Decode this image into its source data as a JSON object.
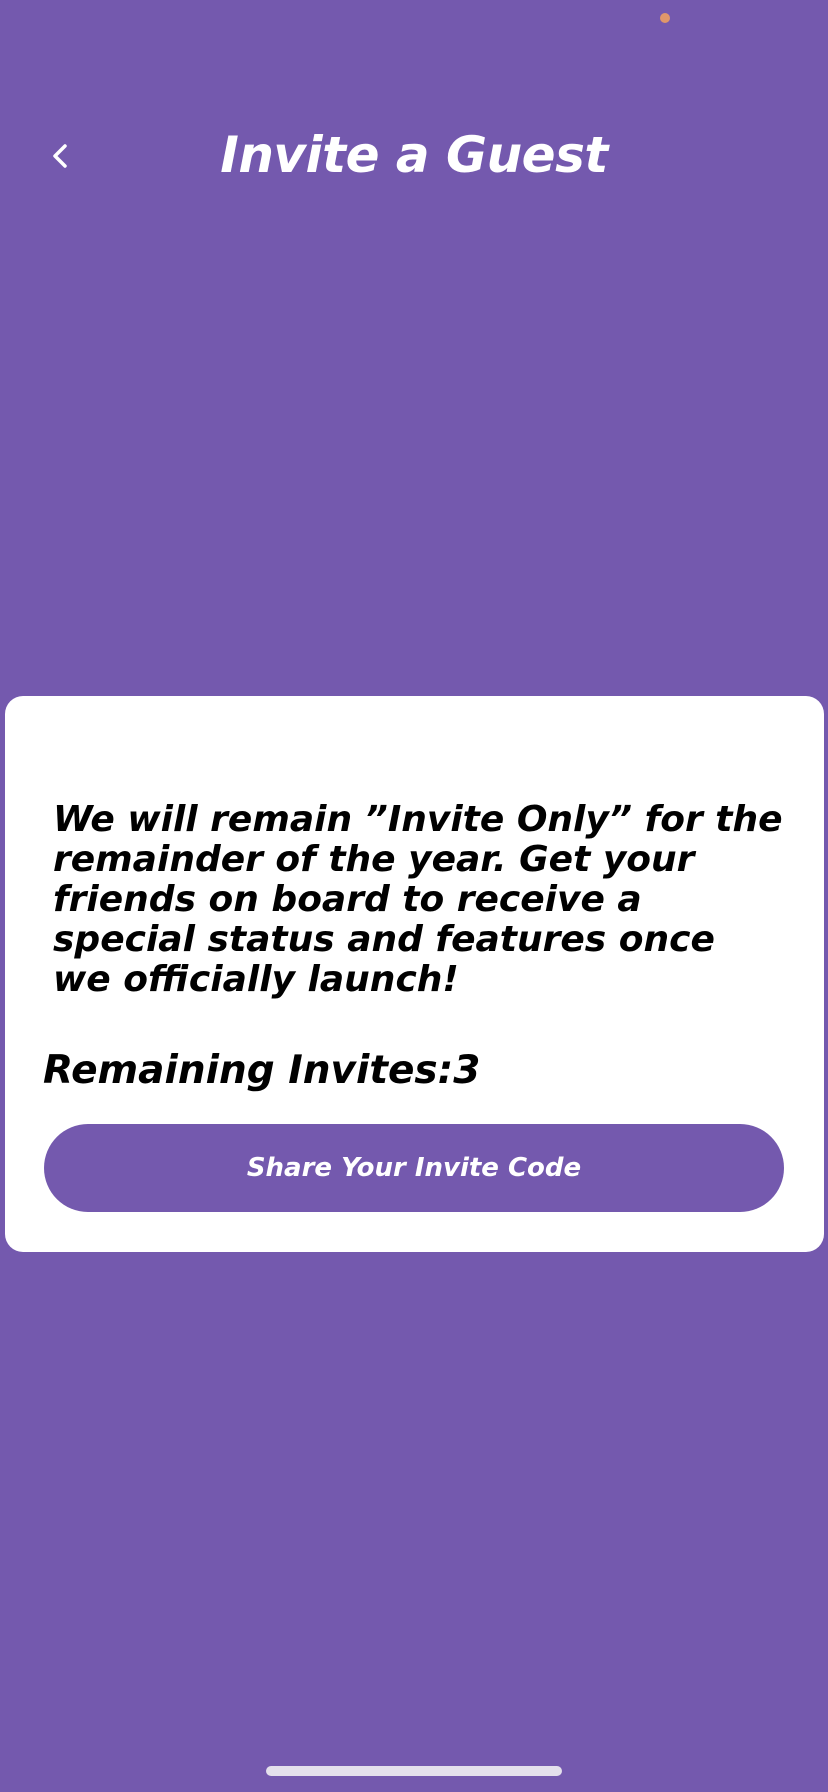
{
  "header": {
    "title": "Invite a Guest",
    "back_icon": "chevron-left-icon"
  },
  "card": {
    "message": "We will remain ”Invite Only” for the remainder of the year. Get your friends on board to receive a special status and features once we officially launch!",
    "remaining_label": "Remaining Invites:",
    "remaining_count": "3",
    "share_button_label": "Share Your Invite Code"
  },
  "colors": {
    "background": "#7459ae",
    "card": "#ffffff",
    "button": "#7459ae",
    "status_dot": "#e0976a"
  }
}
